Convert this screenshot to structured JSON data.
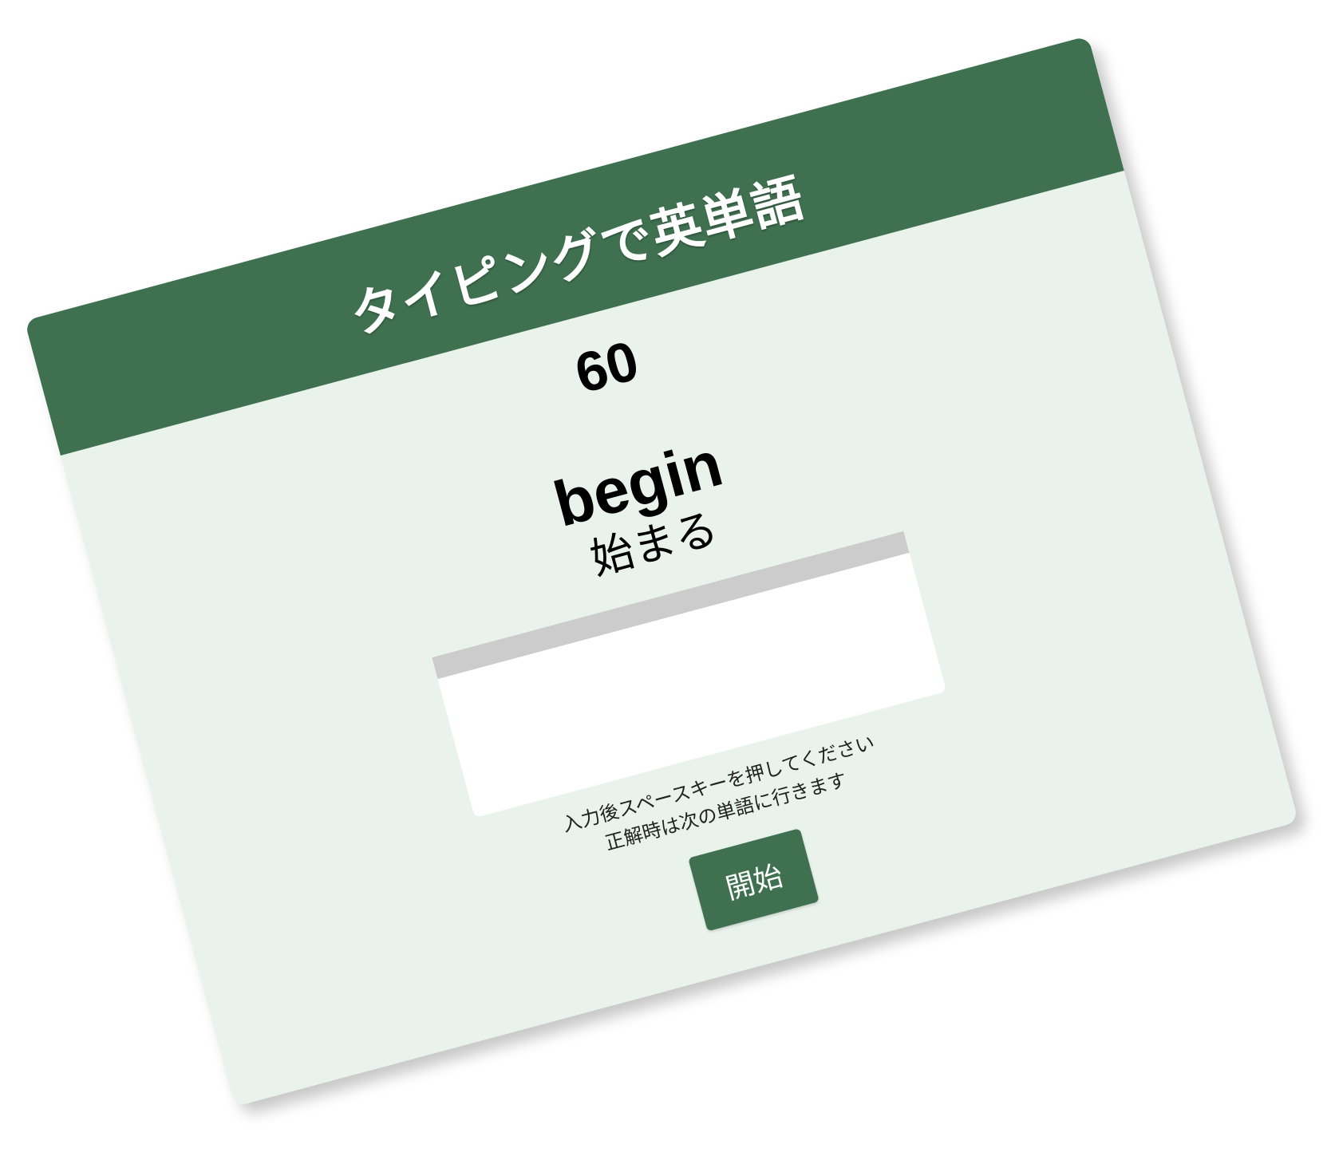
{
  "app": {
    "title": "タイピングで英単語"
  },
  "game": {
    "timer": "60",
    "word": "begin",
    "meaning": "始まる"
  },
  "answer_input": {
    "value": "",
    "placeholder": ""
  },
  "instructions": {
    "line1": "入力後スペースキーを押してください",
    "line2": "正解時は次の単語に行きます"
  },
  "controls": {
    "start_label": "開始"
  },
  "colors": {
    "header_green": "#3f7150",
    "card_background": "#e9f3ec",
    "input_border": "#cccccc",
    "button_green": "#3f7150"
  }
}
